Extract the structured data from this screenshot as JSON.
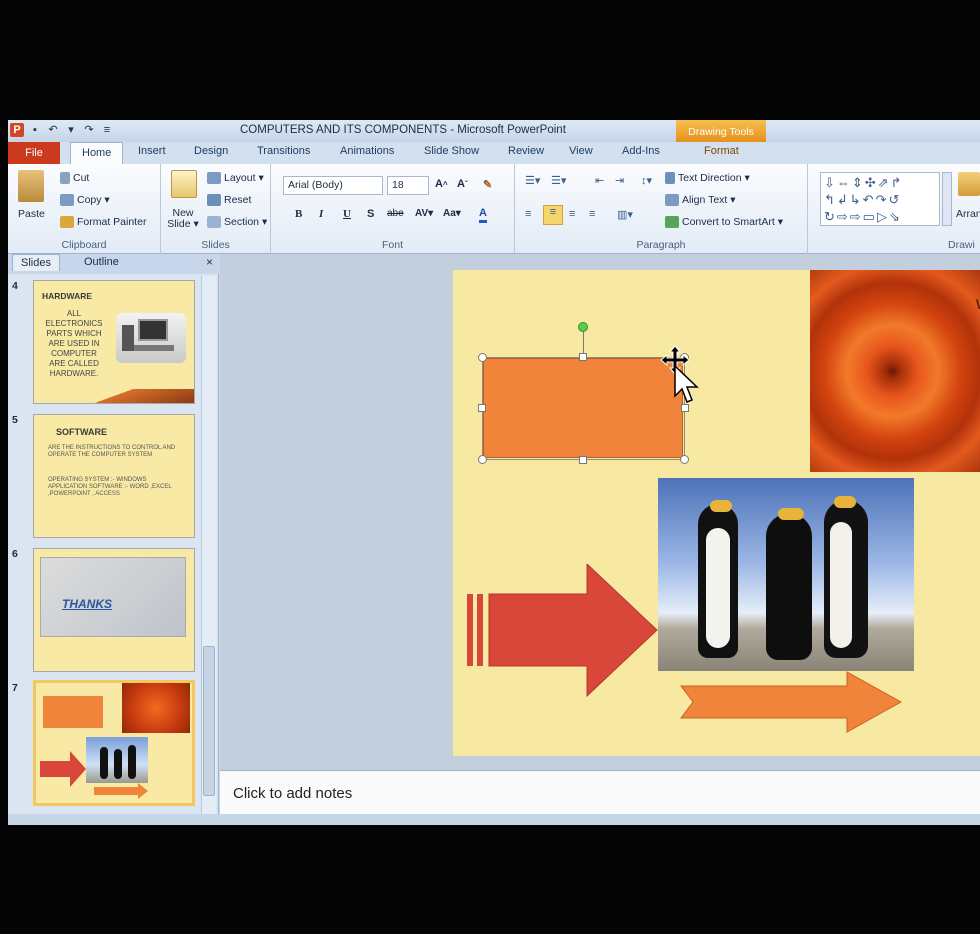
{
  "window": {
    "title": "COMPUTERS AND ITS COMPONENTS  -  Microsoft PowerPoint",
    "contextual_group": "Drawing Tools"
  },
  "tabs": [
    "File",
    "Home",
    "Insert",
    "Design",
    "Transitions",
    "Animations",
    "Slide Show",
    "Review",
    "View",
    "Add-Ins",
    "Format"
  ],
  "ribbon": {
    "clipboard": {
      "paste": "Paste",
      "cut": "Cut",
      "copy": "Copy ▾",
      "format_painter": "Format Painter",
      "label": "Clipboard"
    },
    "slides": {
      "new_slide": "New Slide ▾",
      "layout": "Layout ▾",
      "reset": "Reset",
      "section": "Section ▾",
      "label": "Slides"
    },
    "font": {
      "family": "Arial (Body)",
      "size": "18",
      "label": "Font"
    },
    "paragraph": {
      "text_direction": "Text Direction ▾",
      "align_text": "Align Text ▾",
      "convert_smartart": "Convert to SmartArt ▾",
      "label": "Paragraph"
    },
    "drawing": {
      "arrange": "Arrange",
      "label": "Drawi"
    }
  },
  "pane": {
    "tab_slides": "Slides",
    "tab_outline": "Outline",
    "close": "×",
    "thumbnails": [
      {
        "num": "4",
        "title": "HARDWARE",
        "body": "ALL ELECTRONICS PARTS WHICH ARE USED IN COMPUTER ARE CALLED HARDWARE."
      },
      {
        "num": "5",
        "title": "SOFTWARE",
        "body": "ARE THE INSTRUCTIONS TO CONTROL AND OPERATE THE COMPUTER SYSTEM",
        "body2": "OPERATING SYSTEM :- WINDOWS APPLICATION SOFTWARE :- WORD ,EXCEL ,POWERPOINT , ACCESS"
      },
      {
        "num": "6",
        "title": "THANKS"
      },
      {
        "num": "7"
      }
    ]
  },
  "slide": {
    "corner_text": "WI"
  },
  "notes": {
    "placeholder": "Click to add notes"
  },
  "colors": {
    "slide_bg": "#f8e9a2",
    "orange_shape": "#f0843a",
    "red_arrow": "#d9473a",
    "accent_file": "#cb3a1c"
  }
}
